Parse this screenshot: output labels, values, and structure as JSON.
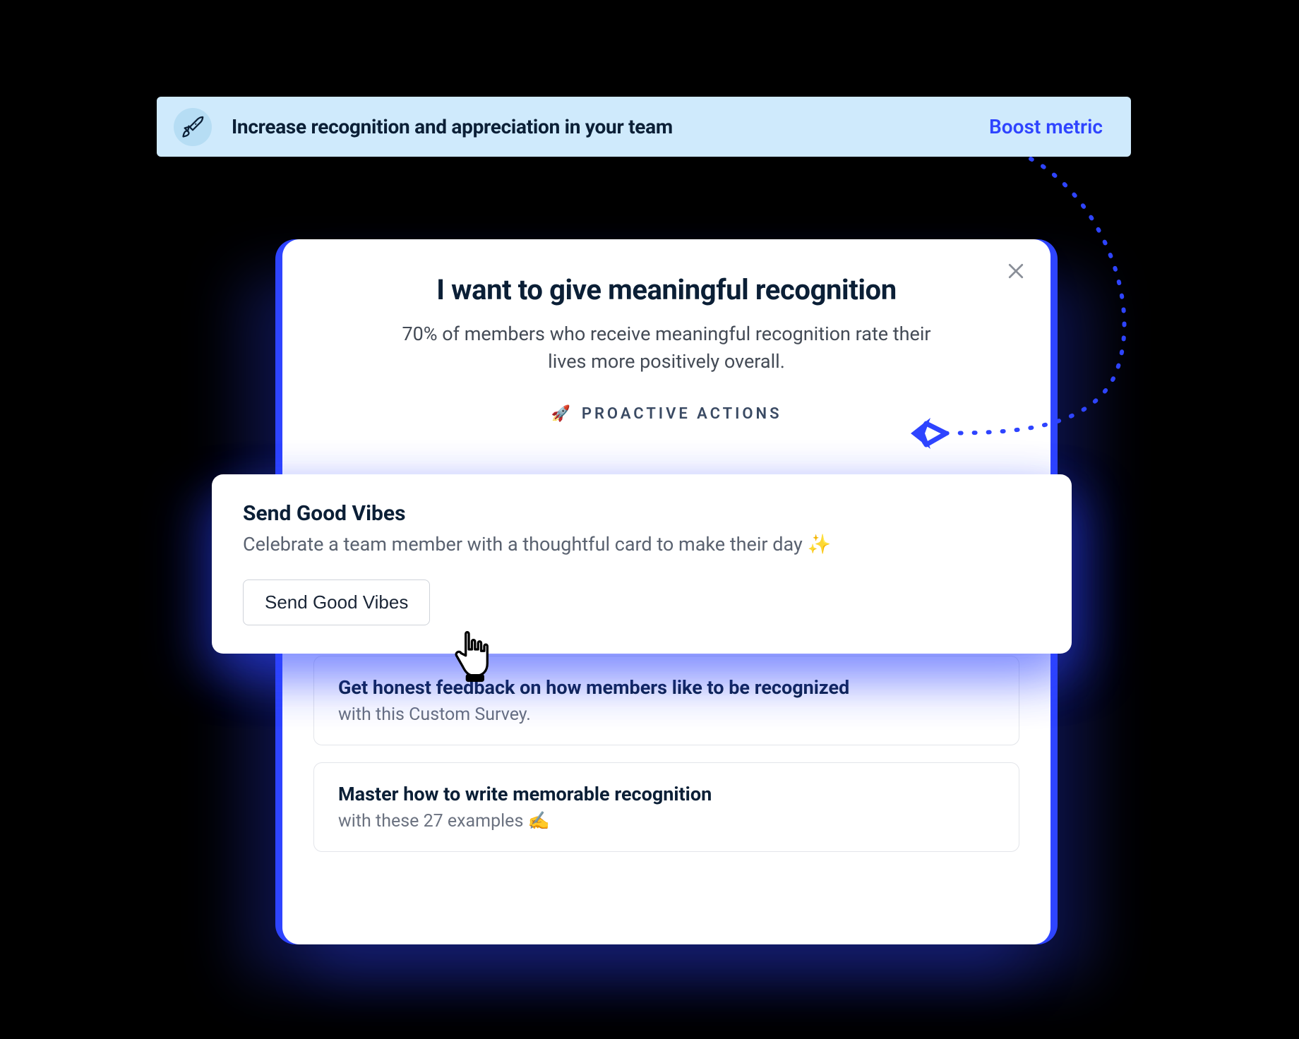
{
  "banner": {
    "title": "Increase recognition and appreciation in your team",
    "cta": "Boost metric"
  },
  "modal": {
    "title": "I want to give meaningful recognition",
    "subtitle": "70% of members who receive meaningful recognition rate their lives more positively overall.",
    "section_label": "PROACTIVE ACTIONS",
    "section_emoji": "🚀",
    "highlighted": {
      "title": "Send Good Vibes",
      "desc": "Celebrate a team member with a thoughtful card to make their day ✨",
      "button": "Send Good Vibes"
    },
    "actions": [
      {
        "title": "Get honest feedback on how members like to be recognized",
        "sub": "with this Custom Survey."
      },
      {
        "title": "Master how to write memorable recognition",
        "sub": "with these 27 examples ✍️"
      }
    ]
  },
  "colors": {
    "accent": "#2e44ff",
    "banner_bg": "#cfeafc"
  }
}
